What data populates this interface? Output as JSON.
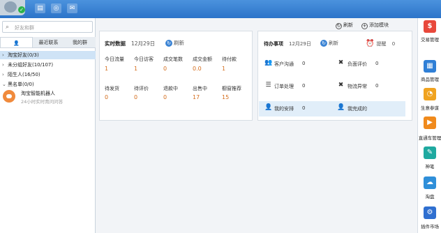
{
  "search": {
    "placeholder": "好友和群"
  },
  "tabs": [
    "最近联系",
    "我的群"
  ],
  "groups": [
    {
      "label": "淘宝好友(0/3)",
      "expanded": false,
      "selected": true
    },
    {
      "label": "未分组好友(10/107)",
      "expanded": false
    },
    {
      "label": "陌生人(16/50)",
      "expanded": false
    },
    {
      "label": "黑名单(0/0)",
      "expanded": true
    }
  ],
  "robot": {
    "name": "淘宝智能机器人",
    "status": "24小时实时育问问答"
  },
  "toolbar": {
    "refresh": "刷新",
    "add_module": "添加模块"
  },
  "realtime": {
    "title": "实时数据",
    "date": "12月29日",
    "refresh": "刷新",
    "row1": [
      {
        "label": "今日流量",
        "value": "1"
      },
      {
        "label": "今日访客",
        "value": "1"
      },
      {
        "label": "成交笔数",
        "value": "0"
      },
      {
        "label": "成交金额",
        "value": "0.0"
      },
      {
        "label": "待付款",
        "value": "1"
      }
    ],
    "row2": [
      {
        "label": "待发货",
        "value": "0"
      },
      {
        "label": "待评价",
        "value": "0"
      },
      {
        "label": "退款中",
        "value": "0"
      },
      {
        "label": "出售中",
        "value": "17"
      },
      {
        "label": "橱窗推荐",
        "value": "15"
      }
    ]
  },
  "todo": {
    "title": "待办事项",
    "date": "12月29日",
    "refresh": "刷新",
    "reminder": "提醒",
    "reminder_count": "0",
    "items": [
      {
        "label": "客户沟通",
        "value": "0",
        "icon": "users-icon"
      },
      {
        "label": "负面评价",
        "value": "0",
        "icon": "negative-review-icon"
      },
      {
        "label": "订单处理",
        "value": "0",
        "icon": "order-icon"
      },
      {
        "label": "物流异常",
        "value": "0",
        "icon": "logistics-icon"
      },
      {
        "label": "我的安排",
        "value": "0",
        "icon": "schedule-icon"
      },
      {
        "label": "我完成的",
        "value": "",
        "icon": "done-icon"
      }
    ]
  },
  "sidebar": [
    {
      "label": "交易管理",
      "icon": "trade-icon",
      "color": "#e8483b"
    },
    {
      "label": "商品管理",
      "icon": "goods-icon",
      "color": "#2f7fd6"
    },
    {
      "label": "生意参谋",
      "icon": "analytics-icon",
      "color": "#f0a320"
    },
    {
      "label": "直通车管理",
      "icon": "ads-icon",
      "color": "#f08a1c"
    },
    {
      "label": "神笔",
      "icon": "pen-icon",
      "color": "#1fa9a0"
    },
    {
      "label": "淘盘",
      "icon": "cloud-icon",
      "color": "#2f8fd9"
    },
    {
      "label": "插件市场",
      "icon": "plugin-icon",
      "color": "#2f6fd0"
    }
  ]
}
